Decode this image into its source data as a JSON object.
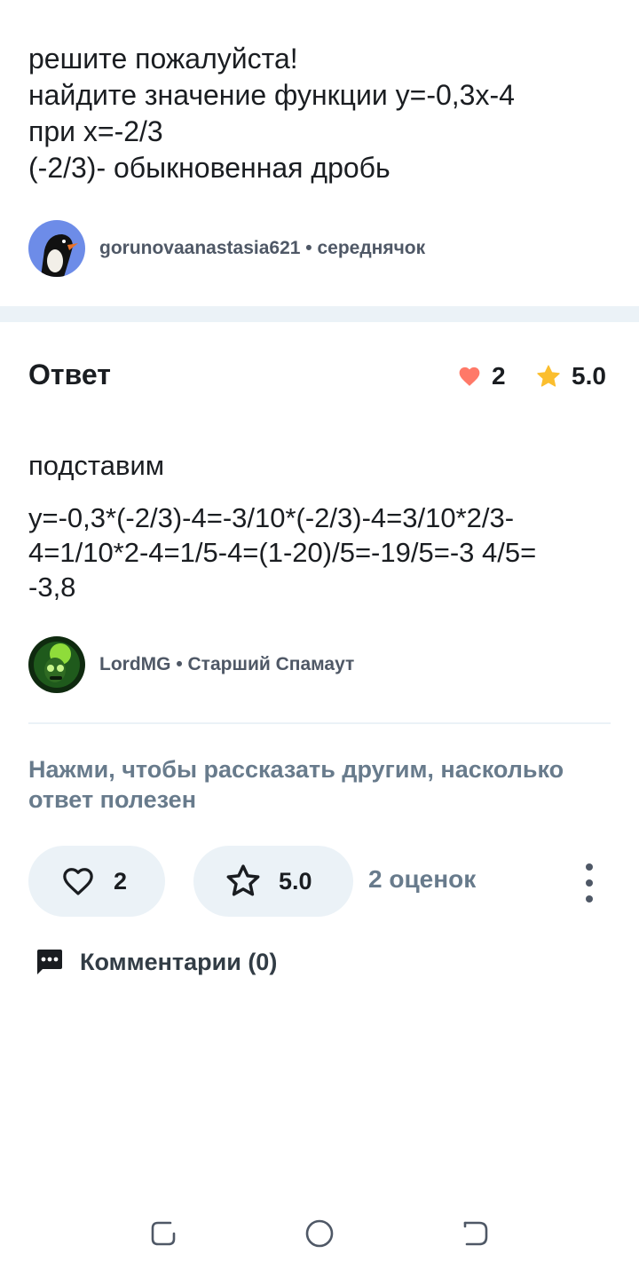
{
  "question": {
    "lines": [
      "решите пожалуйста!",
      "найдите значение функции y=-0,3x-4",
      "при x=-2/3",
      "(-2/3)- обыкновенная дробь"
    ],
    "author": {
      "name": "gorunovaanastasia621",
      "rank": "середнячок",
      "separator": " • "
    }
  },
  "answer": {
    "title": "Ответ",
    "likes": "2",
    "rating": "5.0",
    "text_intro": "подставим",
    "text_lines": [
      "y=-0,3*(-2/3)-4=-3/10*(-2/3)-4=3/10*2/3-",
      "4=1/10*2-4=1/5-4=(1-20)/5=-19/5=-3 4/5=",
      "-3,8"
    ],
    "author": {
      "name": "LordMG",
      "rank": "Старший Спамаут",
      "separator": " • "
    }
  },
  "rate_hint": "Нажми, чтобы рассказать другим, насколько ответ полезен",
  "actions": {
    "like_count": "2",
    "rating_value": "5.0",
    "ratings_count": "2 оценок"
  },
  "comments": {
    "label": "Комментарии (0)"
  },
  "colors": {
    "heart": "#ff7968",
    "star": "#fbbe2e",
    "muted_text": "#687b8c",
    "pill_bg": "#ebf2f7"
  },
  "icons": {
    "like": "heart-icon",
    "star": "star-icon",
    "more": "more-vertical-icon",
    "comment": "comment-bubble-icon",
    "nav": [
      "recent-apps-icon",
      "home-icon",
      "back-icon"
    ]
  }
}
